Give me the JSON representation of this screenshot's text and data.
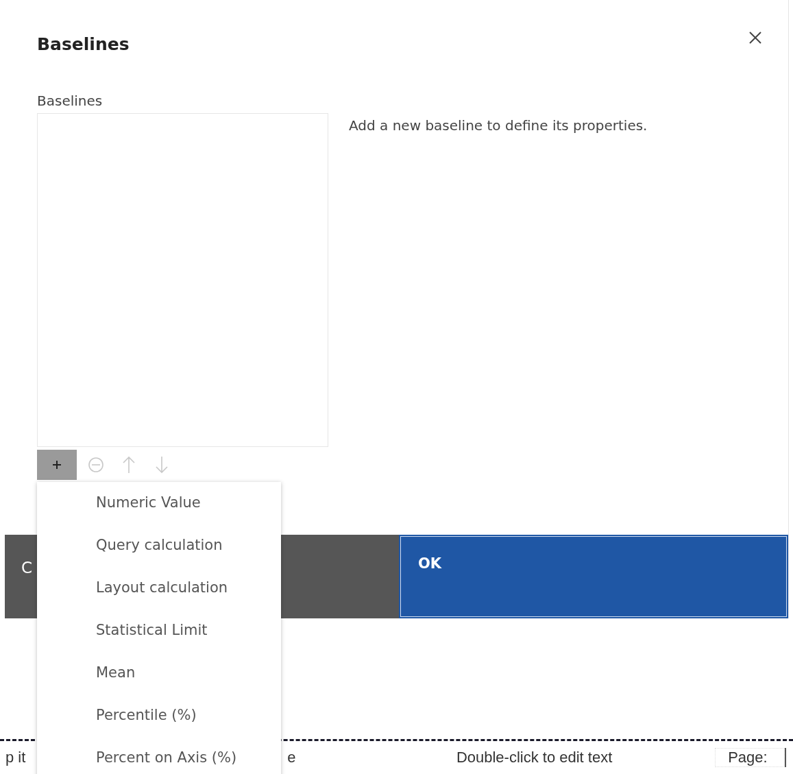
{
  "dialog": {
    "title": "Baselines",
    "list_label": "Baselines",
    "empty_message": "Add a new baseline to define its properties.",
    "toolbar": [
      {
        "kind": "add",
        "active": true,
        "disabled": false
      },
      {
        "kind": "remove",
        "active": false,
        "disabled": true
      },
      {
        "kind": "up",
        "active": false,
        "disabled": true
      },
      {
        "kind": "down",
        "active": false,
        "disabled": true
      }
    ],
    "buttons": [
      {
        "kind": "secondary",
        "label": "C"
      },
      {
        "kind": "primary",
        "label": "OK"
      }
    ]
  },
  "add_menu": {
    "items": [
      "Numeric Value",
      "Query calculation",
      "Layout calculation",
      "Statistical Limit",
      "Mean",
      "Percentile (%)",
      "Percent on Axis (%)"
    ]
  },
  "report_footer": {
    "cells": [
      "p it",
      "e",
      "Double-click to edit text",
      "Page:"
    ]
  }
}
